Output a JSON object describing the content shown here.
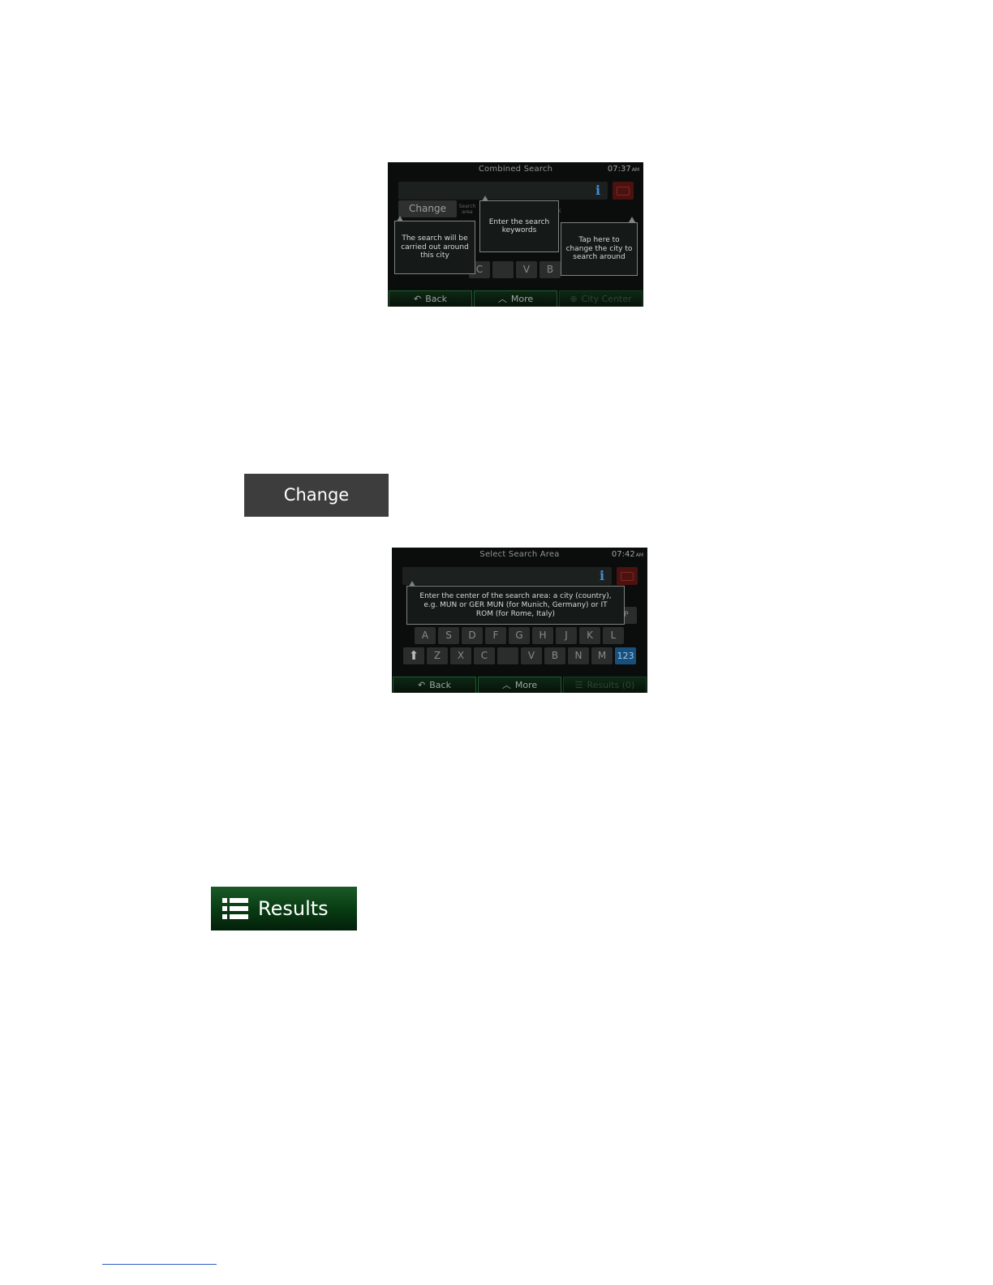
{
  "screen1": {
    "title": "Combined Search",
    "time": "07:37",
    "ampm": "AM",
    "info_glyph": "i",
    "change_label": "Change",
    "search_area_label": "Search area",
    "partial_label": "rk",
    "tooltips": {
      "city": "The search will be carried out around this city",
      "keywords": "Enter the search keywords",
      "change": "Tap here to change the city to search around"
    },
    "visible_keys": [
      "C",
      "V",
      "B"
    ],
    "buttons": {
      "back": "Back",
      "more": "More",
      "city_center": "City Center"
    },
    "icons": {
      "back": "back-arrow-icon",
      "more": "chevron-up-icon",
      "city_center": "crosshair-icon"
    }
  },
  "change_button": {
    "label": "Change"
  },
  "screen2": {
    "title": "Select Search Area",
    "time": "07:42",
    "ampm": "AM",
    "info_glyph": "i",
    "tooltip": "Enter the center of the search area: a city (country), e.g. MUN or GER MUN (for Munich, Germany) or IT ROM (for Rome, Italy)",
    "partial_key": "P",
    "keys_row2": [
      "A",
      "S",
      "D",
      "F",
      "G",
      "H",
      "J",
      "K",
      "L"
    ],
    "keys_row3": [
      "Z",
      "X",
      "C",
      "",
      "V",
      "B",
      "N",
      "M"
    ],
    "numbers_key": "123",
    "buttons": {
      "back": "Back",
      "more": "More",
      "results": "Results (0)"
    },
    "icons": {
      "back": "back-arrow-icon",
      "more": "chevron-up-icon",
      "results": "list-icon",
      "shift": "shift-arrow-icon"
    }
  },
  "results_button": {
    "label": "Results",
    "icon": "list-icon"
  },
  "colors": {
    "change_button_bg": "#3d3d3d",
    "results_button_bg": "#0b4316",
    "device_bg": "#0b0d0c",
    "numbers_key_bg": "#17507e",
    "footnote_rule": "#2f5fbf"
  }
}
